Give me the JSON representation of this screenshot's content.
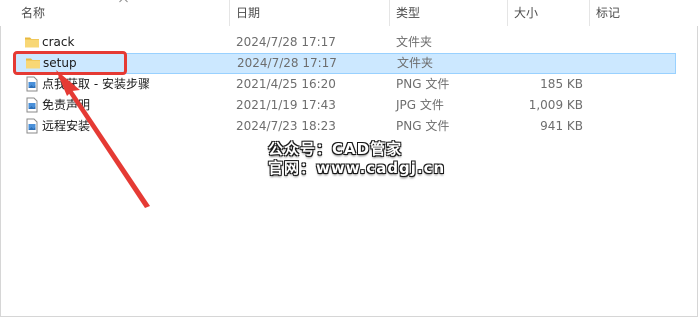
{
  "columns": {
    "name": "名称",
    "date": "日期",
    "type": "类型",
    "size": "大小",
    "tags": "标记"
  },
  "files": [
    {
      "name": "crack",
      "date": "2024/7/28 17:17",
      "type": "文件夹",
      "size": "",
      "icon": "folder-icon"
    },
    {
      "name": "setup",
      "date": "2024/7/28 17:17",
      "type": "文件夹",
      "size": "",
      "icon": "folder-icon",
      "selected": true
    },
    {
      "name": "点我获取 - 安装步骤",
      "date": "2021/4/25 16:20",
      "type": "PNG 文件",
      "size": "185 KB",
      "icon": "png-file-icon"
    },
    {
      "name": "免责声明",
      "date": "2021/1/19 17:43",
      "type": "JPG 文件",
      "size": "1,009 KB",
      "icon": "jpg-file-icon"
    },
    {
      "name": "远程安装",
      "date": "2024/7/23 18:23",
      "type": "PNG 文件",
      "size": "941 KB",
      "icon": "png-file-icon"
    }
  ],
  "watermark": {
    "line1": "公众号：CAD管家",
    "line2": "官网：www.cadgj.cn"
  },
  "colors": {
    "selection_bg": "#cce8ff",
    "selection_border": "#99d1ff",
    "highlight": "#e53a34",
    "folder": "#f8d775"
  }
}
